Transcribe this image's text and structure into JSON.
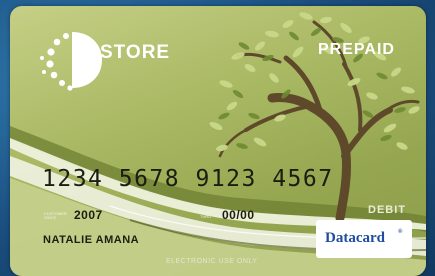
{
  "card": {
    "brand_name": "STORE",
    "brand_initial": "D",
    "type_label": "PREPAID",
    "card_number": "1234 5678 9123 4567",
    "member_since_label": "CUSTOMER SINCE",
    "member_since_value": "2007",
    "valid_thru_label": "VALID THRU",
    "valid_thru_value": "00/00",
    "holder_name": "NATALIE AMANA",
    "network_label": "DEBIT",
    "footer_text": "ELECTRONIC USE ONLY",
    "issuer_logo_text": "Datacard",
    "issuer_logo_mark": "®"
  },
  "colors": {
    "card_base": "#aab964",
    "tree_trunk": "#5e4a2a",
    "leaf_light": "#c9d98a",
    "leaf_dark": "#6f8a34",
    "swoosh": "#eef1dc",
    "logo_blue": "#1f4ea0",
    "background": "#1d5a8c"
  },
  "icons": {
    "logo": "dotted-circle-logo-icon",
    "tree": "tree-illustration"
  }
}
